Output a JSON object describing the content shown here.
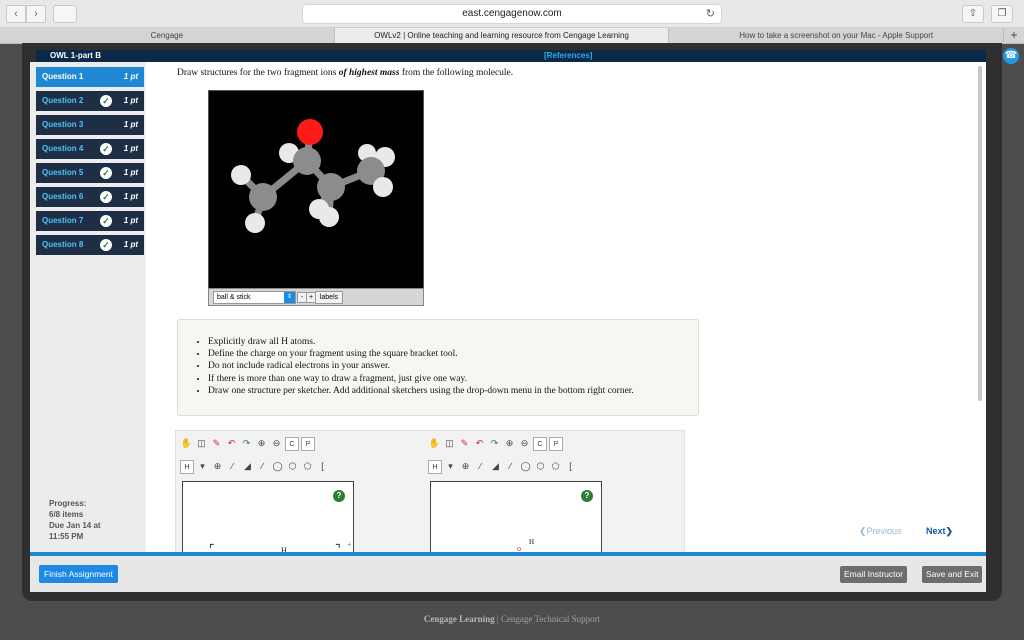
{
  "browser": {
    "url": "east.cengagenow.com",
    "tabs": [
      "Cengage",
      "OWLv2 | Online teaching and learning resource from Cengage Learning",
      "How to take a screenshot on your Mac - Apple Support"
    ],
    "active_tab": 1,
    "new_tab": "+"
  },
  "header": {
    "title": "OWL 1-part B",
    "references": "[References]"
  },
  "questions": [
    {
      "label": "Question 1",
      "points": "1 pt",
      "done": false
    },
    {
      "label": "Question 2",
      "points": "1 pt",
      "done": true
    },
    {
      "label": "Question 3",
      "points": "1 pt",
      "done": false
    },
    {
      "label": "Question 4",
      "points": "1 pt",
      "done": true
    },
    {
      "label": "Question 5",
      "points": "1 pt",
      "done": true
    },
    {
      "label": "Question 6",
      "points": "1 pt",
      "done": true
    },
    {
      "label": "Question 7",
      "points": "1 pt",
      "done": true
    },
    {
      "label": "Question 8",
      "points": "1 pt",
      "done": true
    }
  ],
  "progress": {
    "line1": "Progress:",
    "line2": "6/8 items",
    "line3": "Due Jan 14 at",
    "line4": "11:55 PM"
  },
  "prompt": {
    "before": "Draw structures for the two fragment ions ",
    "emph": "of highest mass",
    "after": " from the following molecule."
  },
  "viewer": {
    "mode": "ball & stick",
    "minus": "-",
    "plus": "+",
    "labels": "labels"
  },
  "instructions": [
    "Explicitly draw all H atoms.",
    "Define the charge on your fragment using the square bracket tool.",
    "Do not include radical electrons in your answer.",
    "If there is more than one way to draw a fragment, just give one way.",
    "Draw one structure per sketcher. Add additional sketchers using the drop-down menu in the bottom right corner."
  ],
  "sketcher": {
    "h_tool": "H",
    "help": "?",
    "frag1": "H",
    "frag1_charge": "+",
    "frag2": "o",
    "frag2_h": "H"
  },
  "nav": {
    "previous": "Previous",
    "next": "Next"
  },
  "actions": {
    "finish": "Finish Assignment",
    "email": "Email Instructor",
    "save": "Save and Exit"
  },
  "footer": {
    "brand": "Cengage Learning",
    "sep": "|",
    "support": "Cengage Technical Support"
  },
  "colors": {
    "accent": "#1e88e5",
    "oxygen": "#ff0000",
    "carbon": "#808080",
    "hydrogen": "#ffffff"
  }
}
